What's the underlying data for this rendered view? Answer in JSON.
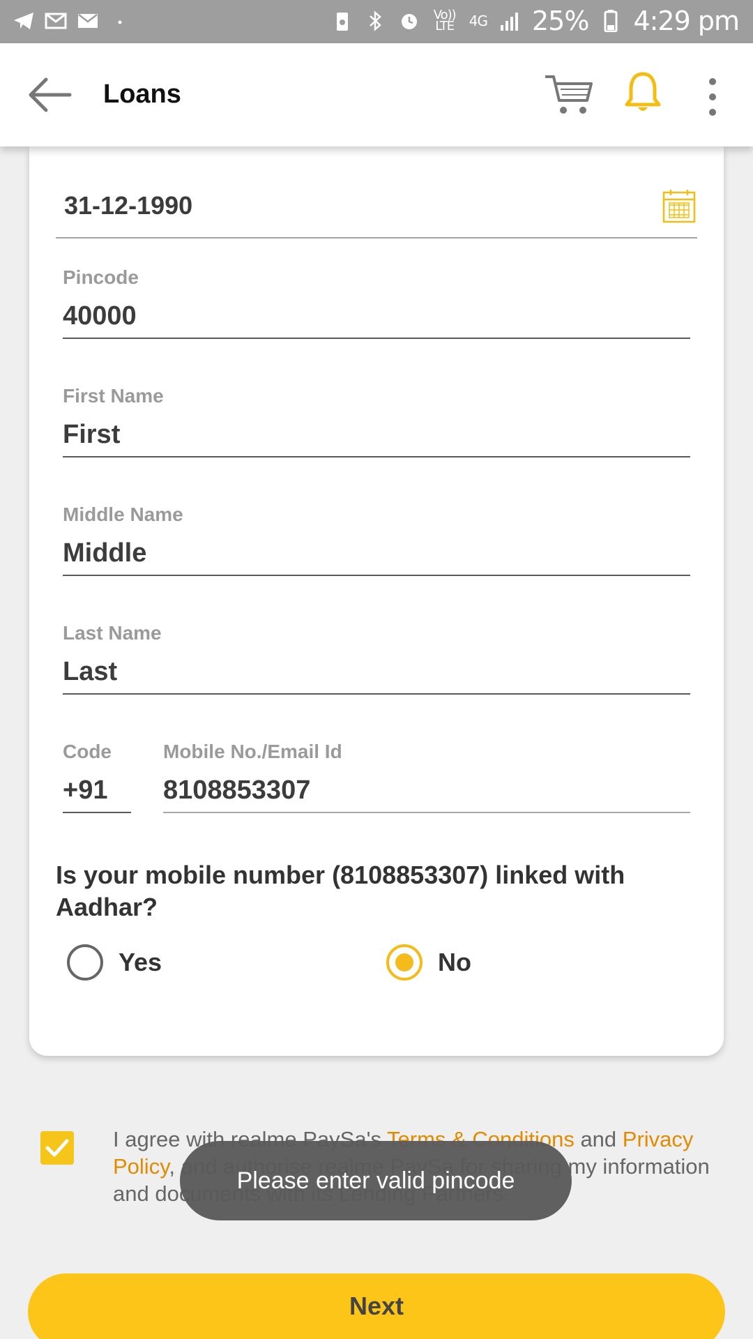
{
  "status_bar": {
    "battery": "25%",
    "time": "4:29 pm",
    "network": "4G",
    "volte": "Vo)) LTE"
  },
  "app_bar": {
    "title": "Loans"
  },
  "form": {
    "dob_value": "31-12-1990",
    "pincode": {
      "label": "Pincode",
      "value": "40000"
    },
    "first_name": {
      "label": "First Name",
      "value": "First"
    },
    "middle_name": {
      "label": "Middle Name",
      "value": "Middle"
    },
    "last_name": {
      "label": "Last Name",
      "value": "Last"
    },
    "code": {
      "label": "Code",
      "value": "+91"
    },
    "mobile": {
      "label": "Mobile No./Email Id",
      "value": "8108853307"
    },
    "question": "Is your mobile number (8108853307) linked with Aadhar?",
    "options": [
      {
        "label": "Yes",
        "selected": false
      },
      {
        "label": "No",
        "selected": true
      }
    ]
  },
  "agreement": {
    "text1": "I agree with realme PaySa's ",
    "terms_link": "Terms & Conditions",
    "text2": " and ",
    "privacy_link": "Privacy Policy",
    "text3": ", and authorise realme PaySa for sharing my information and documents with its Lending Partners.",
    "checked": true
  },
  "toast": "Please enter valid pincode",
  "next_button": "Next",
  "colors": {
    "accent": "#fcc518",
    "link": "#e28a00",
    "status_bar": "#9e9e9e"
  }
}
